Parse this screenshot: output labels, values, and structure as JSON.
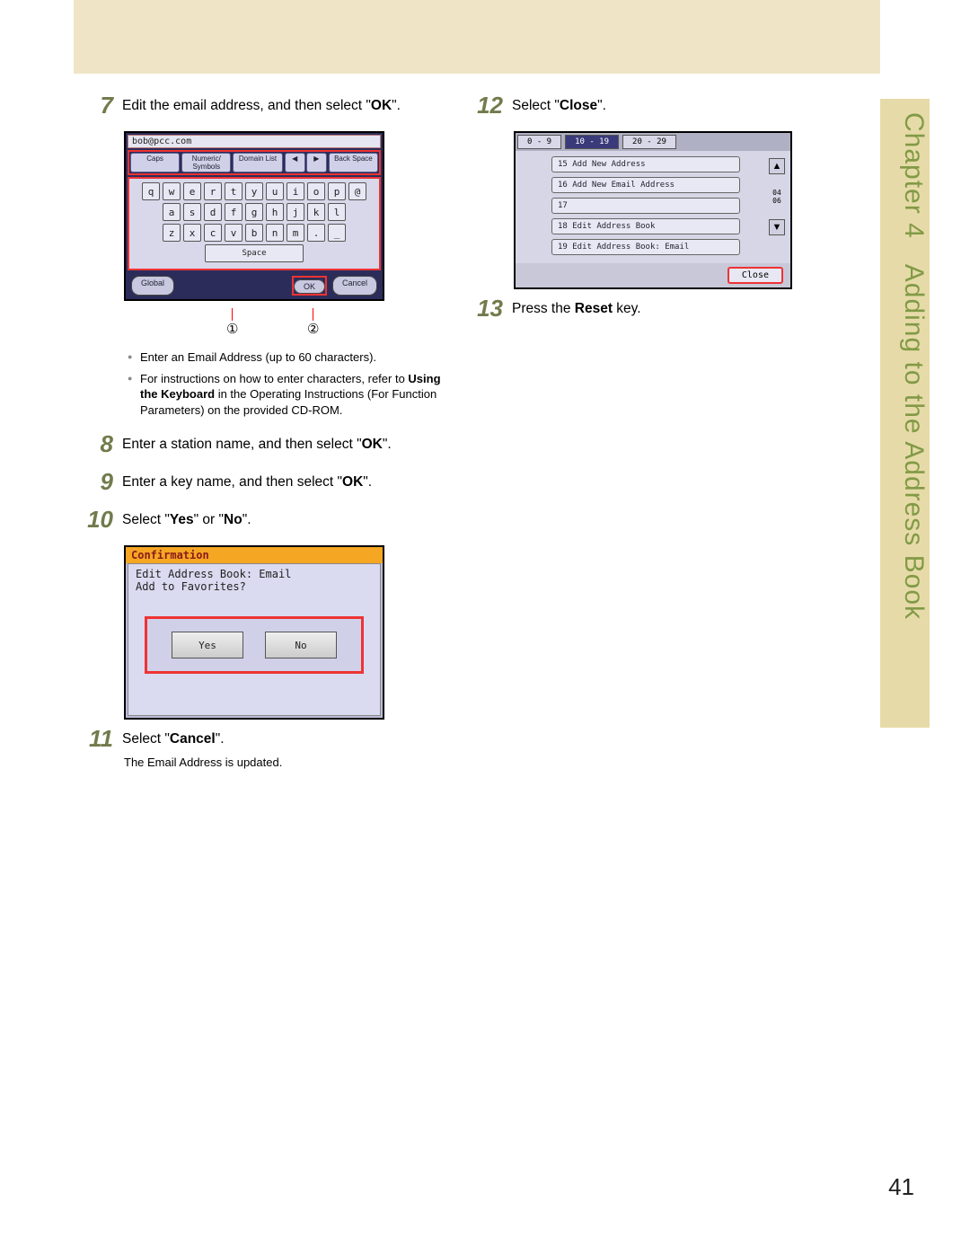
{
  "sideTab": {
    "chapter": "Chapter 4",
    "title": "Adding to the Address Book"
  },
  "pageNumber": "41",
  "steps": {
    "s7": {
      "num": "7",
      "text_a": "Edit the email address, and then select \"",
      "ok": "OK",
      "text_b": "\"."
    },
    "s8": {
      "num": "8",
      "text_a": "Enter a station name, and then select \"",
      "ok": "OK",
      "text_b": "\"."
    },
    "s9": {
      "num": "9",
      "text_a": "Enter a key name, and then select \"",
      "ok": "OK",
      "text_b": "\"."
    },
    "s10": {
      "num": "10",
      "text_a": "Select  \"",
      "yes": "Yes",
      "mid": "\" or \"",
      "no": "No",
      "text_b": "\"."
    },
    "s11": {
      "num": "11",
      "text_a": "Select  \"",
      "cancel": "Cancel",
      "text_b": "\".",
      "note": "The Email Address is updated."
    },
    "s12": {
      "num": "12",
      "text_a": "Select \"",
      "close": "Close",
      "text_b": "\"."
    },
    "s13": {
      "num": "13",
      "text_a": "Press the ",
      "reset": "Reset",
      "text_b": " key."
    }
  },
  "bullets": {
    "b1a": "Enter an Email Address (up to 60 characters).",
    "b2a": "For instructions on how to enter characters, refer to ",
    "b2bold": "Using the Keyboard",
    "b2b": " in the Operating Instructions (For Function Parameters) on the provided CD-ROM."
  },
  "callouts": {
    "c1": "①",
    "c2": "②"
  },
  "kbd": {
    "email": "bob@pcc.com",
    "top": {
      "caps": "Caps",
      "numsym": "Numeric/\nSymbols",
      "domain": "Domain List",
      "left": "◀",
      "right": "▶",
      "back": "Back Space"
    },
    "rows": [
      [
        "q",
        "w",
        "e",
        "r",
        "t",
        "y",
        "u",
        "i",
        "o",
        "p",
        "@"
      ],
      [
        "a",
        "s",
        "d",
        "f",
        "g",
        "h",
        "j",
        "k",
        "l"
      ],
      [
        "z",
        "x",
        "c",
        "v",
        "b",
        "n",
        "m",
        ".",
        "_"
      ]
    ],
    "space": "Space",
    "bottom": {
      "global": "Global",
      "ok": "OK",
      "cancel": "Cancel"
    }
  },
  "conf": {
    "title": "Confirmation",
    "line1": "Edit Address Book: Email",
    "line2": "Add to Favorites?",
    "yes": "Yes",
    "no": "No"
  },
  "menu": {
    "tabs": [
      "0 - 9",
      "10 - 19",
      "20 - 29"
    ],
    "items": [
      "15  Add New Address",
      "16  Add New Email Address",
      "17",
      "18  Edit Address Book",
      "19  Edit Address Book: Email"
    ],
    "counter": "04\n06",
    "close": "Close"
  }
}
